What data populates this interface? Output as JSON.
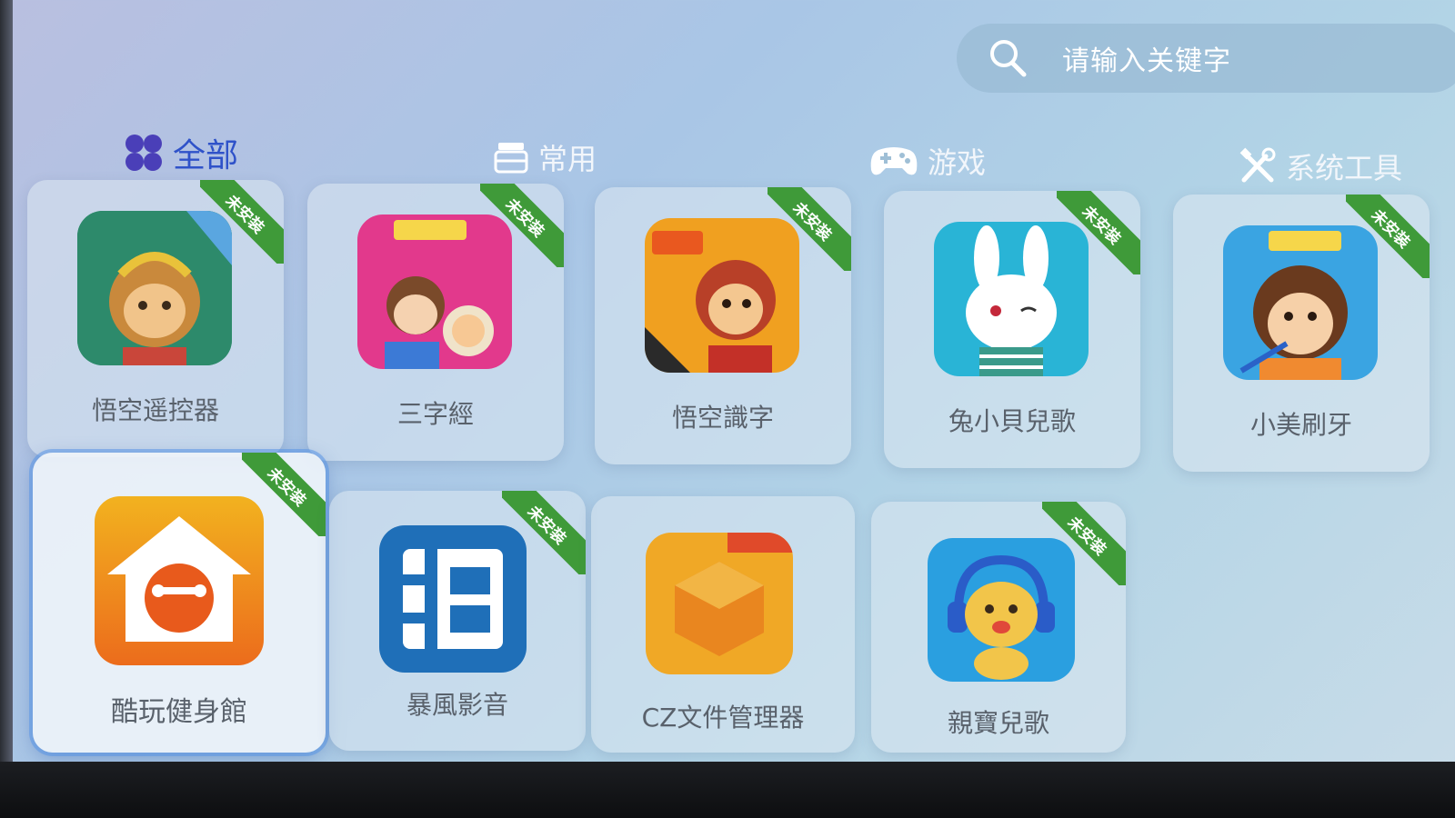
{
  "search": {
    "placeholder": "请输入关键字"
  },
  "tabs": [
    {
      "label": "全部",
      "icon": "grid-icon",
      "active": true
    },
    {
      "label": "常用",
      "icon": "tray-icon",
      "active": false
    },
    {
      "label": "游戏",
      "icon": "gamepad-icon",
      "active": false
    },
    {
      "label": "系统工具",
      "icon": "tools-icon",
      "active": false
    }
  ],
  "badge": "未安装",
  "apps": [
    {
      "name": "悟空遥控器",
      "icon": "monkey-king-tv-icon",
      "badge": "未安装"
    },
    {
      "name": "三字經",
      "icon": "three-character-classic-icon",
      "badge": "未安装"
    },
    {
      "name": "悟空識字",
      "icon": "monkey-king-literacy-icon",
      "badge": "未安装"
    },
    {
      "name": "兔小貝兒歌",
      "icon": "rabbit-songs-icon",
      "badge": "未安装"
    },
    {
      "name": "小美刷牙",
      "icon": "toothbrush-girl-icon",
      "badge": "未安装"
    },
    {
      "name": "酷玩健身館",
      "icon": "fitness-house-icon",
      "badge": "未安装"
    },
    {
      "name": "暴風影音",
      "icon": "film-player-icon",
      "badge": "未安装"
    },
    {
      "name": "CZ文件管理器",
      "icon": "file-manager-icon",
      "badge": null
    },
    {
      "name": "親寶兒歌",
      "icon": "bear-headphones-icon",
      "badge": "未安装"
    }
  ],
  "colors": {
    "active_tab": "#2f52c9",
    "badge_green": "#3f9a39",
    "search_bg": "#96b9d2"
  }
}
